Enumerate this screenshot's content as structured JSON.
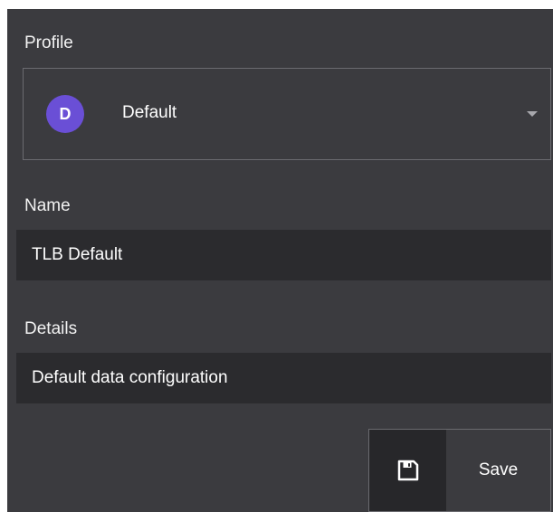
{
  "profile": {
    "label": "Profile",
    "selected": {
      "initial": "D",
      "name": "Default",
      "avatar_color": "#6a4fd6"
    },
    "dropdown_icon": "caret-down-icon"
  },
  "name": {
    "label": "Name",
    "value": "TLB Default"
  },
  "details": {
    "label": "Details",
    "value": "Default data configuration"
  },
  "save": {
    "label": "Save",
    "icon": "floppy-disk-icon"
  },
  "colors": {
    "panel_background": "#3b3b3f",
    "field_background": "#2b2b2e",
    "border": "#6b6b70",
    "text": "#ffffff"
  }
}
